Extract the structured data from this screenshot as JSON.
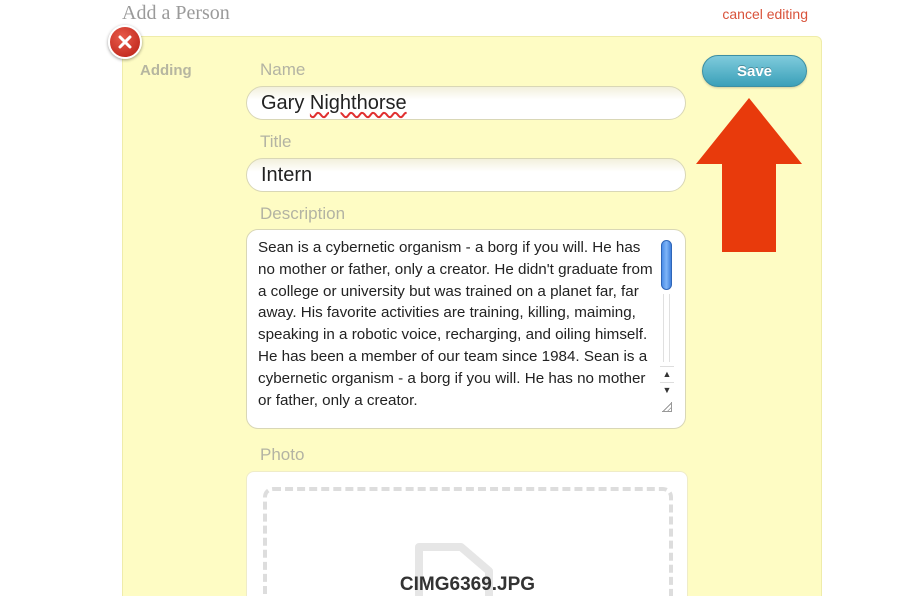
{
  "header": {
    "title": "Add a Person",
    "cancel_label": "cancel editing"
  },
  "form": {
    "state_label": "Adding",
    "name": {
      "label": "Name",
      "value": "Gary Nighthorse"
    },
    "title": {
      "label": "Title",
      "value": "Intern"
    },
    "description": {
      "label": "Description",
      "value": "Sean is a cybernetic organism - a borg if  you will.  He has no mother or father, only a creator.  He didn't graduate from a college or university but was trained on a planet far, far away.  His favorite activities are training, killing, maiming, speaking in a robotic voice, recharging, and oiling himself.  He has been a member of our team since 1984.  Sean is a cybernetic organism - a borg if  you will.  He has no mother or father, only a creator.",
      "scroll_up_glyph": "▲",
      "scroll_down_glyph": "▼"
    },
    "photo": {
      "label": "Photo",
      "file_name": "CIMG6369.JPG"
    },
    "save_label": "Save"
  },
  "icons": {
    "close": "close-icon",
    "arrow": "arrow-up-icon",
    "file": "image-file-icon"
  },
  "colors": {
    "card_background": "#fefcc4",
    "accent_button": "#3aa0b9",
    "cancel_link": "#d9533b",
    "close_button": "#c8281c",
    "annotation_arrow": "#e83a0c"
  }
}
